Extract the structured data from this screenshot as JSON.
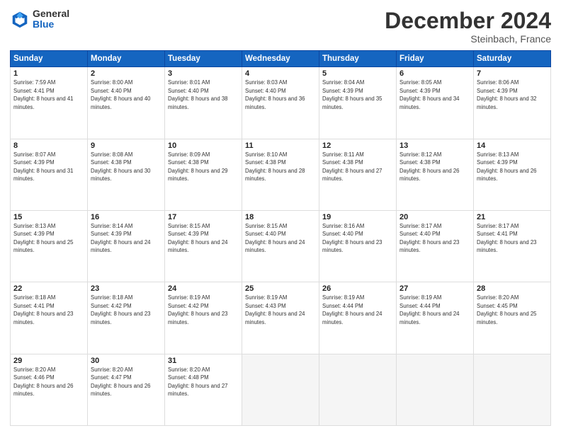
{
  "logo": {
    "general": "General",
    "blue": "Blue"
  },
  "title": "December 2024",
  "subtitle": "Steinbach, France",
  "days_header": [
    "Sunday",
    "Monday",
    "Tuesday",
    "Wednesday",
    "Thursday",
    "Friday",
    "Saturday"
  ],
  "weeks": [
    [
      {
        "day": "1",
        "sunrise": "7:59 AM",
        "sunset": "4:41 PM",
        "daylight": "8 hours and 41 minutes."
      },
      {
        "day": "2",
        "sunrise": "8:00 AM",
        "sunset": "4:40 PM",
        "daylight": "8 hours and 40 minutes."
      },
      {
        "day": "3",
        "sunrise": "8:01 AM",
        "sunset": "4:40 PM",
        "daylight": "8 hours and 38 minutes."
      },
      {
        "day": "4",
        "sunrise": "8:03 AM",
        "sunset": "4:40 PM",
        "daylight": "8 hours and 36 minutes."
      },
      {
        "day": "5",
        "sunrise": "8:04 AM",
        "sunset": "4:39 PM",
        "daylight": "8 hours and 35 minutes."
      },
      {
        "day": "6",
        "sunrise": "8:05 AM",
        "sunset": "4:39 PM",
        "daylight": "8 hours and 34 minutes."
      },
      {
        "day": "7",
        "sunrise": "8:06 AM",
        "sunset": "4:39 PM",
        "daylight": "8 hours and 32 minutes."
      }
    ],
    [
      {
        "day": "8",
        "sunrise": "8:07 AM",
        "sunset": "4:39 PM",
        "daylight": "8 hours and 31 minutes."
      },
      {
        "day": "9",
        "sunrise": "8:08 AM",
        "sunset": "4:38 PM",
        "daylight": "8 hours and 30 minutes."
      },
      {
        "day": "10",
        "sunrise": "8:09 AM",
        "sunset": "4:38 PM",
        "daylight": "8 hours and 29 minutes."
      },
      {
        "day": "11",
        "sunrise": "8:10 AM",
        "sunset": "4:38 PM",
        "daylight": "8 hours and 28 minutes."
      },
      {
        "day": "12",
        "sunrise": "8:11 AM",
        "sunset": "4:38 PM",
        "daylight": "8 hours and 27 minutes."
      },
      {
        "day": "13",
        "sunrise": "8:12 AM",
        "sunset": "4:38 PM",
        "daylight": "8 hours and 26 minutes."
      },
      {
        "day": "14",
        "sunrise": "8:13 AM",
        "sunset": "4:39 PM",
        "daylight": "8 hours and 26 minutes."
      }
    ],
    [
      {
        "day": "15",
        "sunrise": "8:13 AM",
        "sunset": "4:39 PM",
        "daylight": "8 hours and 25 minutes."
      },
      {
        "day": "16",
        "sunrise": "8:14 AM",
        "sunset": "4:39 PM",
        "daylight": "8 hours and 24 minutes."
      },
      {
        "day": "17",
        "sunrise": "8:15 AM",
        "sunset": "4:39 PM",
        "daylight": "8 hours and 24 minutes."
      },
      {
        "day": "18",
        "sunrise": "8:15 AM",
        "sunset": "4:40 PM",
        "daylight": "8 hours and 24 minutes."
      },
      {
        "day": "19",
        "sunrise": "8:16 AM",
        "sunset": "4:40 PM",
        "daylight": "8 hours and 23 minutes."
      },
      {
        "day": "20",
        "sunrise": "8:17 AM",
        "sunset": "4:40 PM",
        "daylight": "8 hours and 23 minutes."
      },
      {
        "day": "21",
        "sunrise": "8:17 AM",
        "sunset": "4:41 PM",
        "daylight": "8 hours and 23 minutes."
      }
    ],
    [
      {
        "day": "22",
        "sunrise": "8:18 AM",
        "sunset": "4:41 PM",
        "daylight": "8 hours and 23 minutes."
      },
      {
        "day": "23",
        "sunrise": "8:18 AM",
        "sunset": "4:42 PM",
        "daylight": "8 hours and 23 minutes."
      },
      {
        "day": "24",
        "sunrise": "8:19 AM",
        "sunset": "4:42 PM",
        "daylight": "8 hours and 23 minutes."
      },
      {
        "day": "25",
        "sunrise": "8:19 AM",
        "sunset": "4:43 PM",
        "daylight": "8 hours and 24 minutes."
      },
      {
        "day": "26",
        "sunrise": "8:19 AM",
        "sunset": "4:44 PM",
        "daylight": "8 hours and 24 minutes."
      },
      {
        "day": "27",
        "sunrise": "8:19 AM",
        "sunset": "4:44 PM",
        "daylight": "8 hours and 24 minutes."
      },
      {
        "day": "28",
        "sunrise": "8:20 AM",
        "sunset": "4:45 PM",
        "daylight": "8 hours and 25 minutes."
      }
    ],
    [
      {
        "day": "29",
        "sunrise": "8:20 AM",
        "sunset": "4:46 PM",
        "daylight": "8 hours and 26 minutes."
      },
      {
        "day": "30",
        "sunrise": "8:20 AM",
        "sunset": "4:47 PM",
        "daylight": "8 hours and 26 minutes."
      },
      {
        "day": "31",
        "sunrise": "8:20 AM",
        "sunset": "4:48 PM",
        "daylight": "8 hours and 27 minutes."
      },
      null,
      null,
      null,
      null
    ]
  ]
}
